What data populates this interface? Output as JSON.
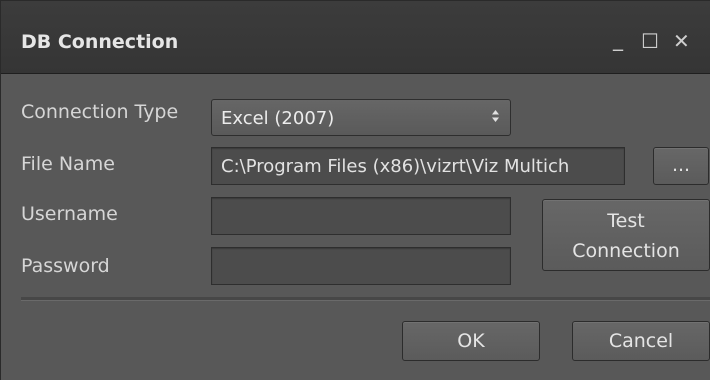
{
  "window": {
    "title": "DB Connection",
    "minimize_glyph": "_",
    "maximize_glyph": "☐",
    "close_glyph": "✕"
  },
  "form": {
    "connection_type_label": "Connection Type",
    "connection_type_value": "Excel (2007)",
    "file_name_label": "File Name",
    "file_name_value": "C:\\Program Files (x86)\\vizrt\\Viz Multich",
    "browse_label": "...",
    "username_label": "Username",
    "username_value": "",
    "password_label": "Password",
    "password_value": "",
    "test_button_line1": "Test",
    "test_button_line2": "Connection"
  },
  "footer": {
    "ok_label": "OK",
    "cancel_label": "Cancel"
  },
  "colors": {
    "titlebar": "#383838",
    "body": "#585858",
    "field": "#4c4c4c",
    "text": "#d6d6d6"
  }
}
